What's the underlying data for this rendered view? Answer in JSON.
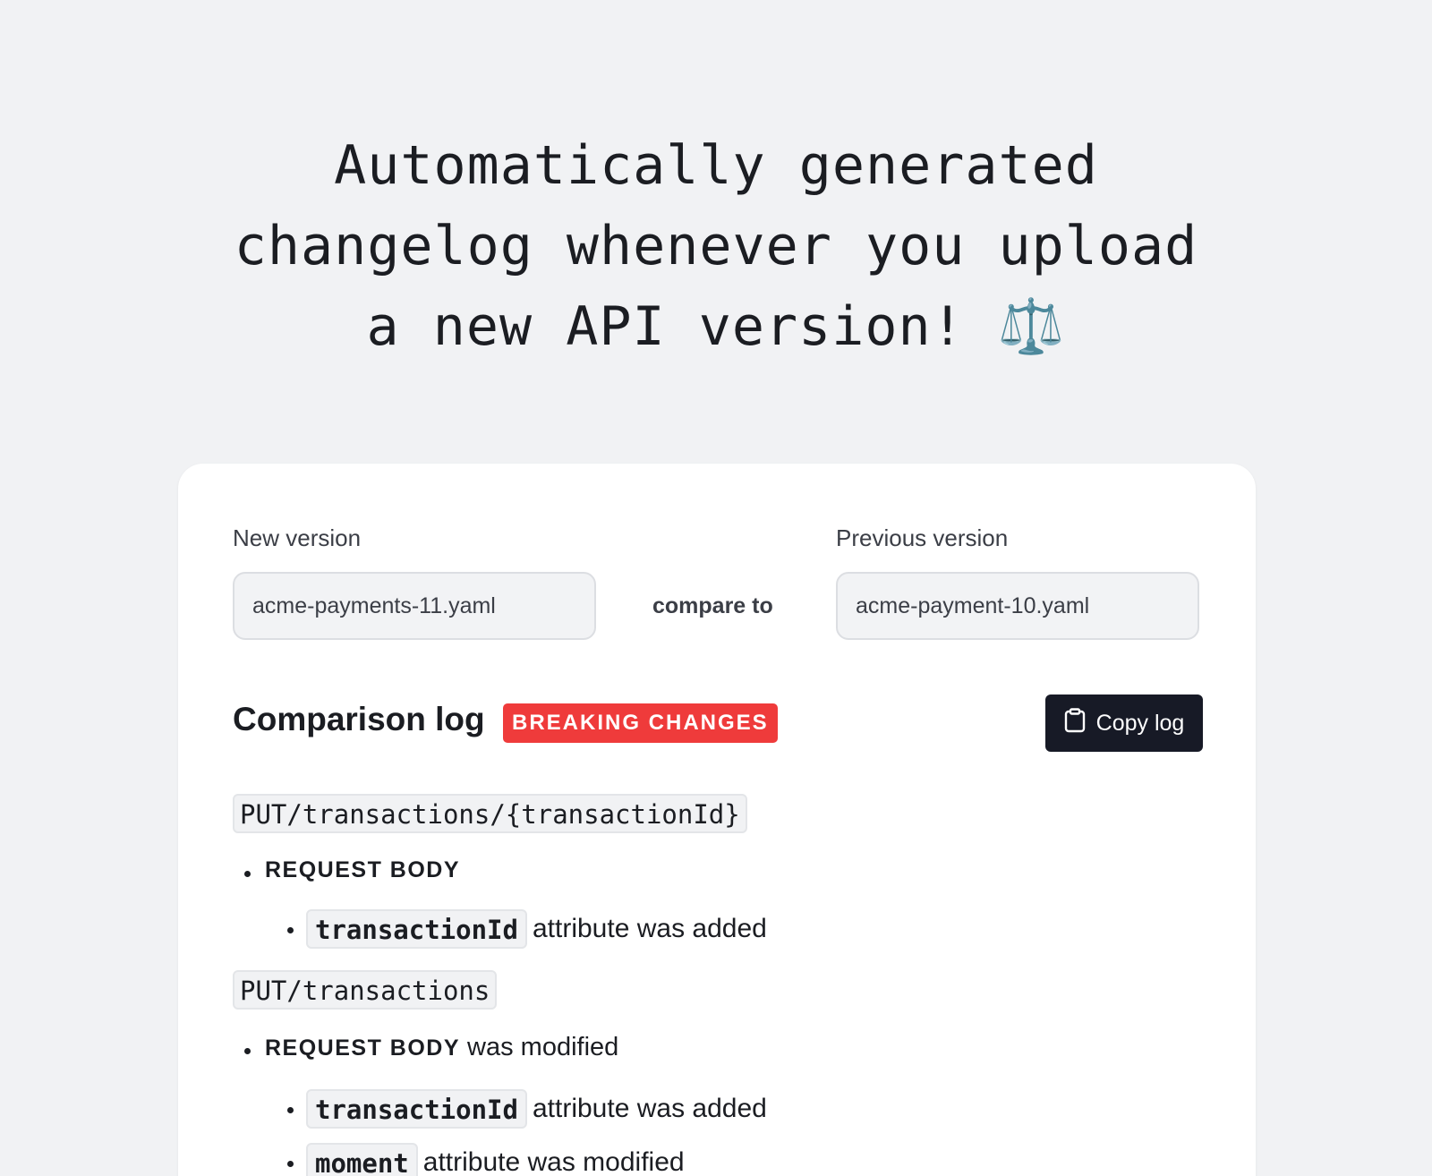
{
  "headline": {
    "line1": "Automatically generated",
    "line2": "changelog whenever you upload",
    "line3": "a new API version! ⚖️"
  },
  "form": {
    "new_version_label": "New version",
    "new_version_value": "acme-payments-11.yaml",
    "compare_label": "compare to",
    "previous_version_label": "Previous version",
    "previous_version_value": "acme-payment-10.yaml"
  },
  "log": {
    "title": "Comparison log",
    "badge": "BREAKING CHANGES",
    "badge_color": "#ef3b3b",
    "copy_button": "Copy log",
    "copy_icon": "clipboard-icon",
    "entries": [
      {
        "endpoint": "PUT/transactions/{transactionId}",
        "section": "REQUEST BODY",
        "section_suffix": "",
        "changes": [
          {
            "attribute": "transactionId",
            "text": "attribute was added"
          }
        ]
      },
      {
        "endpoint": "PUT/transactions",
        "section": "REQUEST BODY",
        "section_suffix": "was modified",
        "changes": [
          {
            "attribute": "transactionId",
            "text": "attribute was added"
          },
          {
            "attribute": "moment",
            "text": "attribute was modified"
          }
        ]
      }
    ]
  }
}
